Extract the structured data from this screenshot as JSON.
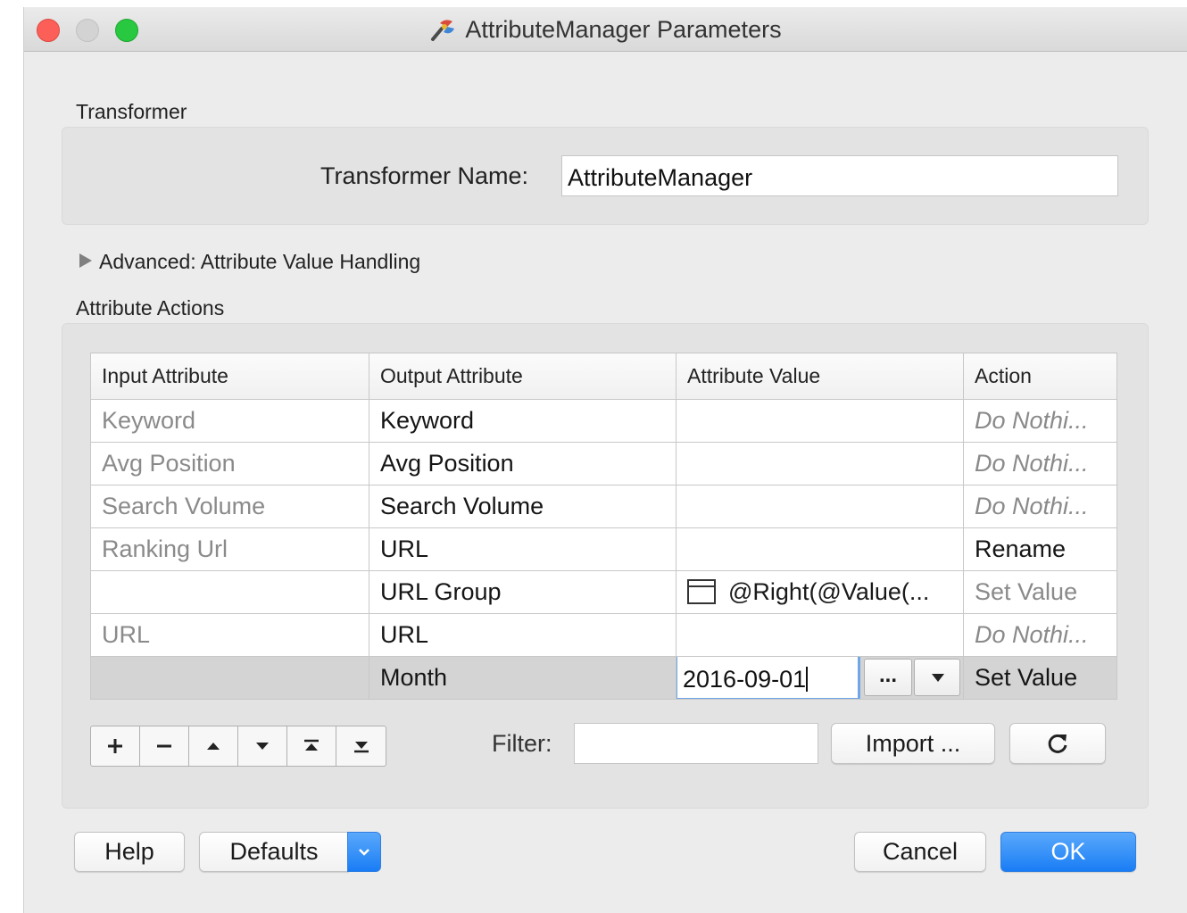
{
  "window": {
    "title": "AttributeManager Parameters",
    "icon": "transformer-icon"
  },
  "transformer": {
    "section_label": "Transformer",
    "name_label": "Transformer Name:",
    "name_value": "AttributeManager"
  },
  "advanced": {
    "label": "Advanced: Attribute Value Handling"
  },
  "attribute_actions": {
    "section_label": "Attribute Actions",
    "columns": [
      "Input Attribute",
      "Output Attribute",
      "Attribute Value",
      "Action"
    ],
    "rows": [
      {
        "input": "Keyword",
        "output": "Keyword",
        "value": "",
        "action": "Do Nothi..."
      },
      {
        "input": "Avg Position",
        "output": "Avg Position",
        "value": "",
        "action": "Do Nothi..."
      },
      {
        "input": "Search Volume",
        "output": "Search Volume",
        "value": "",
        "action": "Do Nothi..."
      },
      {
        "input": "Ranking Url",
        "output": "URL",
        "value": "",
        "action": "Rename"
      },
      {
        "input": "",
        "output": "URL Group",
        "value": "@Right(@Value(...",
        "action": "Set Value"
      },
      {
        "input": "URL",
        "output": "URL",
        "value": "",
        "action": "Do Nothi..."
      },
      {
        "input": "",
        "output": "Month",
        "value": "2016-09-01",
        "action": "Set Value"
      }
    ],
    "ellipsis_button": "...",
    "filter_label": "Filter:",
    "filter_value": "",
    "import_button": "Import ..."
  },
  "footer": {
    "help": "Help",
    "defaults": "Defaults",
    "cancel": "Cancel",
    "ok": "OK"
  },
  "colors": {
    "accent": "#1a7df5",
    "close": "#fc5f57",
    "maximize": "#28c840",
    "focus_ring": "#6ea6e6"
  }
}
